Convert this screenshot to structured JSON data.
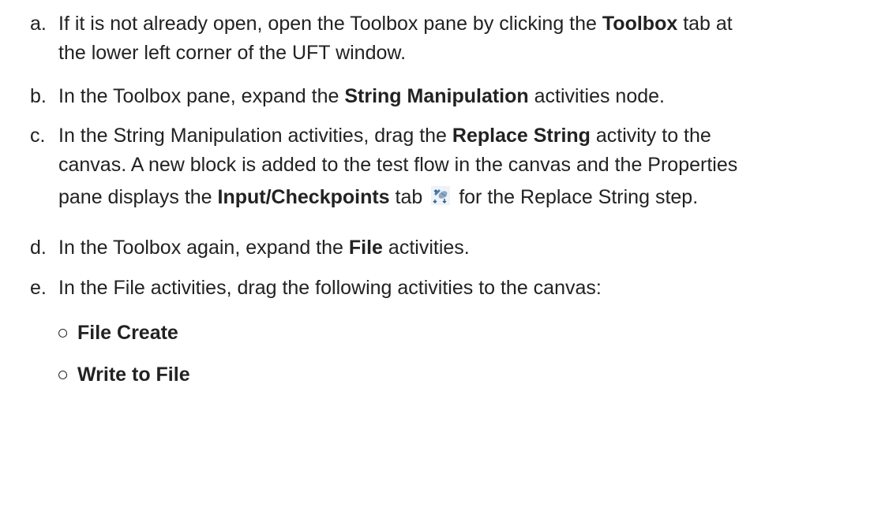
{
  "steps": [
    {
      "letter": "a.",
      "t1": "If it is not already open, open the Toolbox pane by clicking the ",
      "b1": "Toolbox",
      "t2": " tab at",
      "t3": "the lower left corner of the UFT window."
    },
    {
      "letter": "b.",
      "t1": "In the Toolbox pane, expand the ",
      "b1": "String Manipulation",
      "t2": " activities node."
    },
    {
      "letter": "c.",
      "t1": "In the String Manipulation activities, drag the ",
      "b1": "Replace String",
      "t2": " activity to the",
      "t3": "canvas. A new block is added to the test flow in the canvas and the Properties",
      "t4": "pane displays the ",
      "b2": "Input/Checkpoints",
      "t5": " tab ",
      "t6": " for the Replace String step.",
      "icon": "input-checkpoints-tab-icon"
    },
    {
      "letter": "d.",
      "t1": "In the Toolbox again, expand the ",
      "b1": "File",
      "t2": " activities."
    },
    {
      "letter": "e.",
      "t1": "In the File activities, drag the following activities to the canvas:"
    }
  ],
  "bullets": [
    {
      "marker": "○",
      "label": "File Create"
    },
    {
      "marker": "○",
      "label": "Write to File"
    }
  ],
  "colors": {
    "text": "#222222",
    "background": "#ffffff"
  }
}
